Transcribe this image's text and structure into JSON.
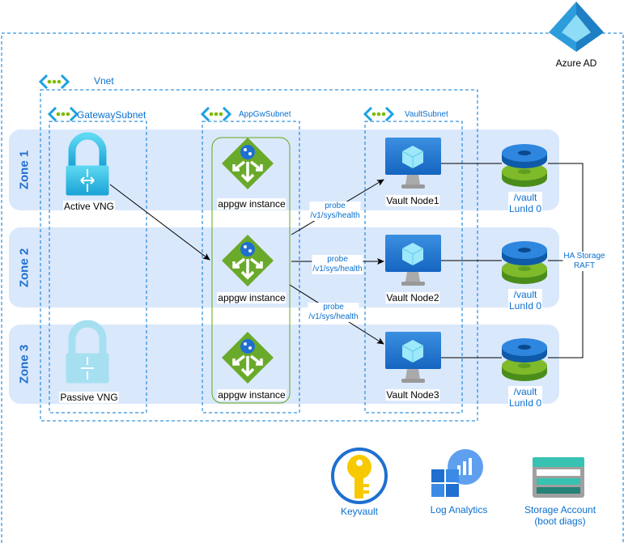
{
  "identity": {
    "label": "Azure AD"
  },
  "vnet": {
    "label": "Vnet"
  },
  "subnets": [
    {
      "label": "GatewaySubnet"
    },
    {
      "label": "AppGwSubnet"
    },
    {
      "label": "VaultSubnet"
    }
  ],
  "zones": [
    {
      "label": "Zone 1"
    },
    {
      "label": "Zone 2"
    },
    {
      "label": "Zone 3"
    }
  ],
  "gateways": [
    {
      "label": "Active VNG",
      "state": "active"
    },
    {
      "label": "Passive VNG",
      "state": "passive"
    }
  ],
  "appgw_instances": [
    {
      "label": "appgw instance"
    },
    {
      "label": "appgw instance"
    },
    {
      "label": "appgw instance"
    }
  ],
  "vault_nodes": [
    {
      "label": "Vault Node1"
    },
    {
      "label": "Vault Node2"
    },
    {
      "label": "Vault Node3"
    }
  ],
  "disks": [
    {
      "line1": "/vault",
      "line2": "LunId 0"
    },
    {
      "line1": "/vault",
      "line2": "LunId 0"
    },
    {
      "line1": "/vault",
      "line2": "LunId 0"
    }
  ],
  "probes": [
    {
      "line1": "probe",
      "line2": "/v1/sys/health"
    },
    {
      "line1": "probe",
      "line2": "/v1/sys/health"
    },
    {
      "line1": "probe",
      "line2": "/v1/sys/health"
    }
  ],
  "storage_link": {
    "line1": "HA Storage",
    "line2": "RAFT"
  },
  "services": [
    {
      "label": "Keyvault",
      "icon": "key-vault-icon"
    },
    {
      "label": "Log Analytics",
      "icon": "log-analytics-icon"
    },
    {
      "label": "Storage Account",
      "sublabel": "(boot diags)",
      "icon": "storage-account-icon"
    }
  ],
  "colors": {
    "border": "#0078d4",
    "zone_fill": "#dae8fc",
    "appgw_group": "#60a917",
    "text_blue": "#0a6fd0"
  }
}
